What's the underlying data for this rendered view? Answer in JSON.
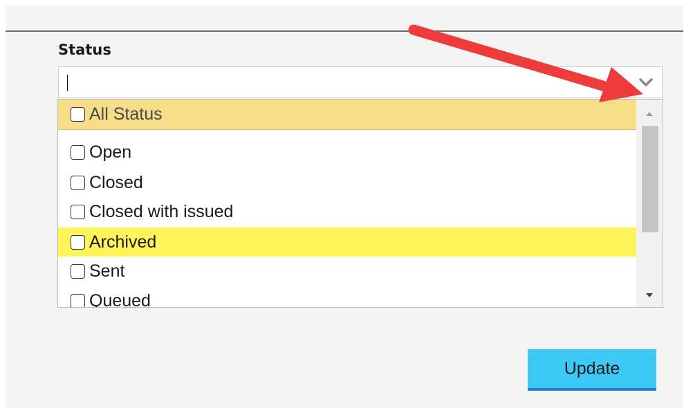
{
  "status_field": {
    "label": "Status",
    "input_value": "",
    "options": [
      {
        "label": "All Status",
        "checked": false,
        "state": "selected"
      },
      {
        "label": "Open",
        "checked": false,
        "state": "normal"
      },
      {
        "label": "Closed",
        "checked": false,
        "state": "normal"
      },
      {
        "label": "Closed with issued",
        "checked": false,
        "state": "normal"
      },
      {
        "label": "Archived",
        "checked": false,
        "state": "hover"
      },
      {
        "label": "Sent",
        "checked": false,
        "state": "normal"
      },
      {
        "label": "Queued",
        "checked": false,
        "state": "normal"
      }
    ]
  },
  "actions": {
    "update_label": "Update"
  },
  "icons": {
    "dropdown_toggle": "chevron-down-icon",
    "scroll_up": "triangle-up-icon",
    "scroll_down": "triangle-down-icon",
    "annotation": "red-arrow-icon"
  },
  "colors": {
    "selected_row": "#f6de88",
    "hover_row": "#fff45a",
    "button": "#3ec8f5",
    "button_border": "#1e7fc2",
    "annotation_arrow": "#ee3b3b"
  }
}
